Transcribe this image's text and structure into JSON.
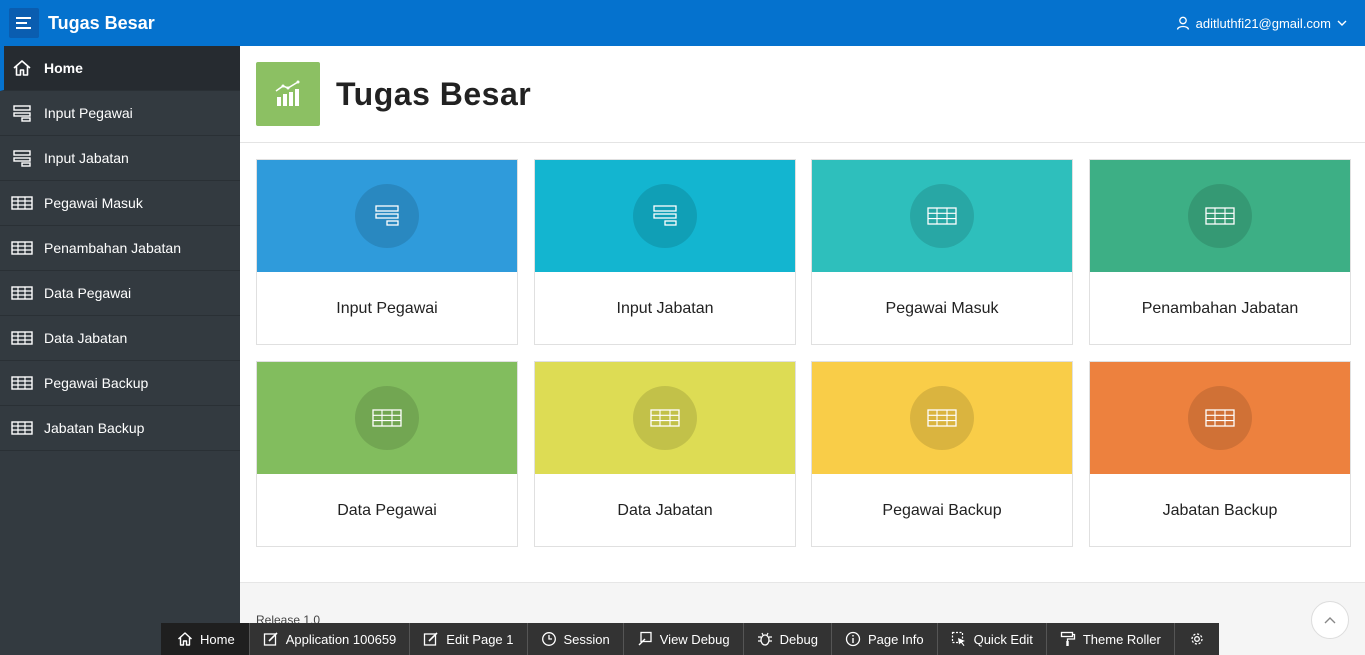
{
  "header": {
    "app_title": "Tugas Besar",
    "user": "aditluthfi21@gmail.com"
  },
  "sidebar": {
    "items": [
      {
        "label": "Home",
        "icon": "home-icon",
        "active": true
      },
      {
        "label": "Input Pegawai",
        "icon": "form-icon"
      },
      {
        "label": "Input Jabatan",
        "icon": "form-icon"
      },
      {
        "label": "Pegawai Masuk",
        "icon": "table-icon"
      },
      {
        "label": "Penambahan Jabatan",
        "icon": "table-icon"
      },
      {
        "label": "Data Pegawai",
        "icon": "table-icon"
      },
      {
        "label": "Data Jabatan",
        "icon": "table-icon"
      },
      {
        "label": "Pegawai Backup",
        "icon": "table-icon"
      },
      {
        "label": "Jabatan Backup",
        "icon": "table-icon"
      }
    ]
  },
  "hero": {
    "title": "Tugas Besar",
    "icon": "chart-icon",
    "icon_color": "#8cc063"
  },
  "cards": [
    {
      "label": "Input Pegawai",
      "icon": "form-icon",
      "color": "#2f9bdb"
    },
    {
      "label": "Input Jabatan",
      "icon": "form-icon",
      "color": "#13b5d0"
    },
    {
      "label": "Pegawai Masuk",
      "icon": "table-icon",
      "color": "#2ebfbc"
    },
    {
      "label": "Penambahan Jabatan",
      "icon": "table-icon",
      "color": "#3daf85"
    },
    {
      "label": "Data Pegawai",
      "icon": "table-icon",
      "color": "#82bd5e"
    },
    {
      "label": "Data Jabatan",
      "icon": "table-icon",
      "color": "#dddc54"
    },
    {
      "label": "Pegawai Backup",
      "icon": "table-icon",
      "color": "#f9cd48"
    },
    {
      "label": "Jabatan Backup",
      "icon": "table-icon",
      "color": "#ed813e"
    }
  ],
  "footer": {
    "release": "Release 1.0"
  },
  "devbar": {
    "items": [
      {
        "label": "Home",
        "icon": "home-icon"
      },
      {
        "label": "Application 100659",
        "icon": "edit-icon"
      },
      {
        "label": "Edit Page 1",
        "icon": "edit-icon"
      },
      {
        "label": "Session",
        "icon": "clock-icon"
      },
      {
        "label": "View Debug",
        "icon": "view-debug-icon"
      },
      {
        "label": "Debug",
        "icon": "bug-icon"
      },
      {
        "label": "Page Info",
        "icon": "info-icon"
      },
      {
        "label": "Quick Edit",
        "icon": "cursor-icon"
      },
      {
        "label": "Theme Roller",
        "icon": "paint-roller-icon"
      }
    ]
  }
}
